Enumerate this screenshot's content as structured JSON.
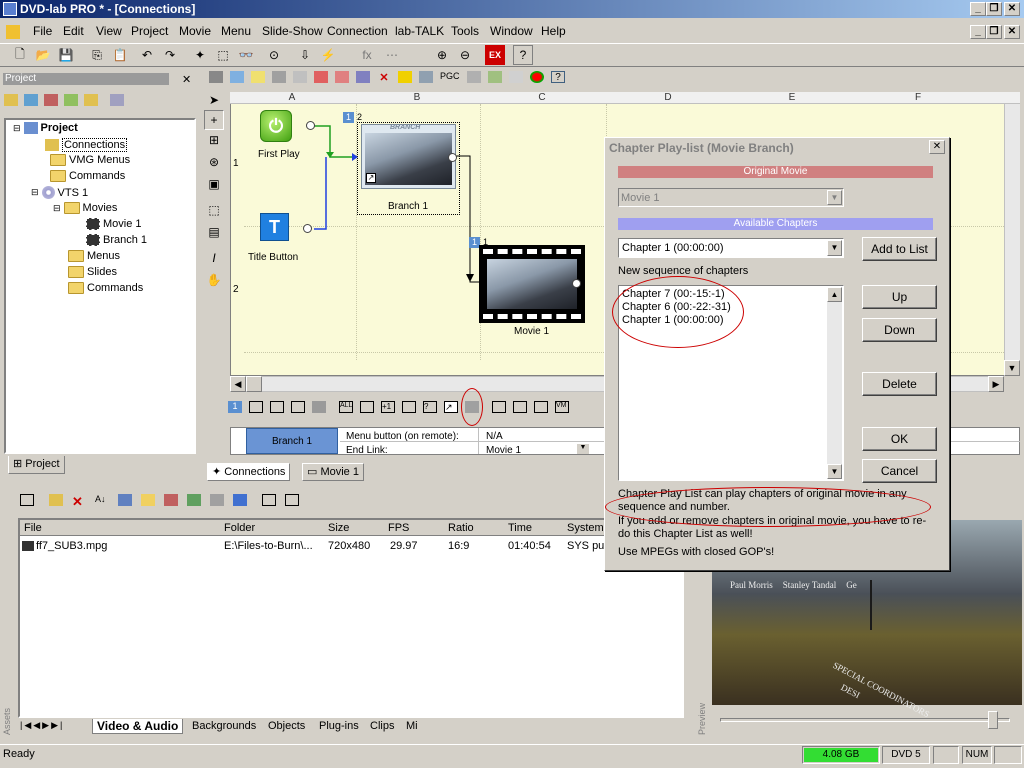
{
  "window": {
    "title": "DVD-lab PRO * - [Connections]"
  },
  "menu": [
    "File",
    "Edit",
    "View",
    "Project",
    "Movie",
    "Menu",
    "Slide-Show",
    "Connection",
    "lab-TALK",
    "Tools",
    "Window",
    "Help"
  ],
  "project_panel": {
    "title": "Project",
    "tree": {
      "root": "Project",
      "connections": "Connections",
      "vmg_menus": "VMG Menus",
      "commands": "Commands",
      "vts": "VTS 1",
      "movies": "Movies",
      "movie1": "Movie 1",
      "branch1": "Branch 1",
      "menus": "Menus",
      "slides": "Slides",
      "commands2": "Commands"
    },
    "tab": "Project"
  },
  "canvas": {
    "columns": [
      "A",
      "B",
      "C",
      "D",
      "E",
      "F"
    ],
    "rows": [
      "1",
      "2"
    ],
    "nodes": {
      "first_play": "First Play",
      "title_button": "Title Button",
      "branch1": "Branch 1",
      "branch_tag": "BRANCH",
      "movie1": "Movie 1",
      "badge1": "1",
      "badge2": "2",
      "badge3": "1",
      "badge4": "1"
    }
  },
  "properties": {
    "name": "Branch 1",
    "row1_label": "Menu button (on remote):",
    "row1_value": "N/A",
    "row2_label": "End Link:",
    "row2_value": "Movie 1"
  },
  "doc_tabs": {
    "connections": "Connections",
    "movie1": "Movie 1"
  },
  "assets": {
    "columns": [
      "File",
      "Folder",
      "Size",
      "FPS",
      "Ratio",
      "Time",
      "System"
    ],
    "rows": [
      [
        "ff7_SUB3.mpg",
        "E:\\Files-to-Burn\\...",
        "720x480",
        "29.97",
        "16:9",
        "01:40:54",
        "SYS pul"
      ]
    ],
    "side_label": "Assets",
    "tabs": [
      "Video & Audio",
      "Backgrounds",
      "Objects",
      "Plug-ins",
      "Clips",
      "Mi"
    ]
  },
  "preview": {
    "side_label": "Preview",
    "credits": [
      "Paul Morris",
      "Stanley Tandal",
      "Ge"
    ],
    "overlay_text": "SPECIAL COORDINATORS",
    "overlay_text2": "DESI"
  },
  "dialog": {
    "title": "Chapter Play-list (Movie Branch)",
    "original_movie_label": "Original Movie",
    "original_movie_value": "Movie 1",
    "available_label": "Available Chapters",
    "chapter_select": "Chapter 1 (00:00:00)",
    "add_button": "Add to List",
    "sequence_label": "New sequence of chapters",
    "sequence": [
      "Chapter 7 (00:-15:-1)",
      "Chapter 6 (00:-22:-31)",
      "Chapter 1 (00:00:00)"
    ],
    "up": "Up",
    "down": "Down",
    "delete": "Delete",
    "ok": "OK",
    "cancel": "Cancel",
    "note1": "Chapter Play List can play chapters of original movie in any sequence and number.",
    "note2": "If you add or remove chapters in original movie, you have to re-do this Chapter List as well!",
    "note3": "Use MPEGs with closed GOP's!"
  },
  "status": {
    "text": "Ready",
    "disk": "4.08 GB",
    "dvd": "DVD 5",
    "num": "NUM"
  },
  "colors": {
    "titlebar": "#0a246a",
    "original_bar": "#d08080",
    "available_bar": "#9f9ff0",
    "canvas": "#fafad8",
    "disk_meter": "#33dd33",
    "annotation": "#cc0000"
  }
}
